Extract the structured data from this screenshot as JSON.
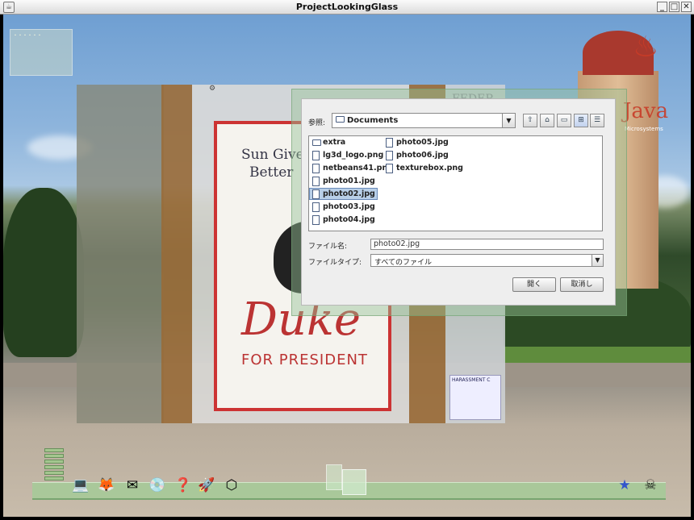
{
  "window": {
    "title": "ProjectLookingGlass",
    "app_icon": "java-cup-icon",
    "controls": [
      "minimize",
      "maximize",
      "close"
    ],
    "control_glyphs": [
      "□",
      "□",
      "✕"
    ]
  },
  "minimap": {
    "label": "・・・・・・"
  },
  "photo": {
    "poster_line1": "Sun Give",
    "poster_line2": "Better",
    "poster_title": "Duke",
    "poster_subtitle": "FOR PRESIDENT",
    "board_header": "FEDER",
    "notice_title": "HARASSMENT C"
  },
  "java_logo": {
    "text": "Java",
    "sub": "Microsystems"
  },
  "file_chooser": {
    "look_in_label": "参照:",
    "look_in_value": "Documents",
    "toolbar": {
      "up_icon": "folder-up-icon",
      "home_icon": "home-icon",
      "new_folder_icon": "new-folder-icon",
      "list_view_icon": "list-view-icon",
      "details_view_icon": "details-view-icon"
    },
    "files": [
      {
        "name": "extra",
        "type": "folder",
        "selected": false
      },
      {
        "name": "lg3d_logo.png",
        "type": "file",
        "selected": false
      },
      {
        "name": "netbeans41.png",
        "type": "file",
        "selected": false
      },
      {
        "name": "photo01.jpg",
        "type": "file",
        "selected": false
      },
      {
        "name": "photo02.jpg",
        "type": "file",
        "selected": true
      },
      {
        "name": "photo03.jpg",
        "type": "file",
        "selected": false
      },
      {
        "name": "photo04.jpg",
        "type": "file",
        "selected": false
      },
      {
        "name": "photo05.jpg",
        "type": "file",
        "selected": false
      },
      {
        "name": "photo06.jpg",
        "type": "file",
        "selected": false
      },
      {
        "name": "texturebox.png",
        "type": "file",
        "selected": false
      }
    ],
    "filename_label": "ファイル名:",
    "filename_value": "photo02.jpg",
    "filetype_label": "ファイルタイプ:",
    "filetype_value": "すべてのファイル",
    "open_label": "開く",
    "cancel_label": "取消し"
  },
  "dock": {
    "icons": [
      "computer-icon",
      "firefox-icon",
      "mail-icon",
      "cd-icon",
      "help-icon",
      "rocket-icon",
      "cube-icon"
    ],
    "icon_glyphs": [
      "💻",
      "🦊",
      "✉",
      "💿",
      "❓",
      "🚀",
      "⬡"
    ],
    "right_icons": [
      "star-person-icon",
      "pirate-flag-icon"
    ],
    "right_glyphs": [
      "★",
      "☠"
    ]
  }
}
